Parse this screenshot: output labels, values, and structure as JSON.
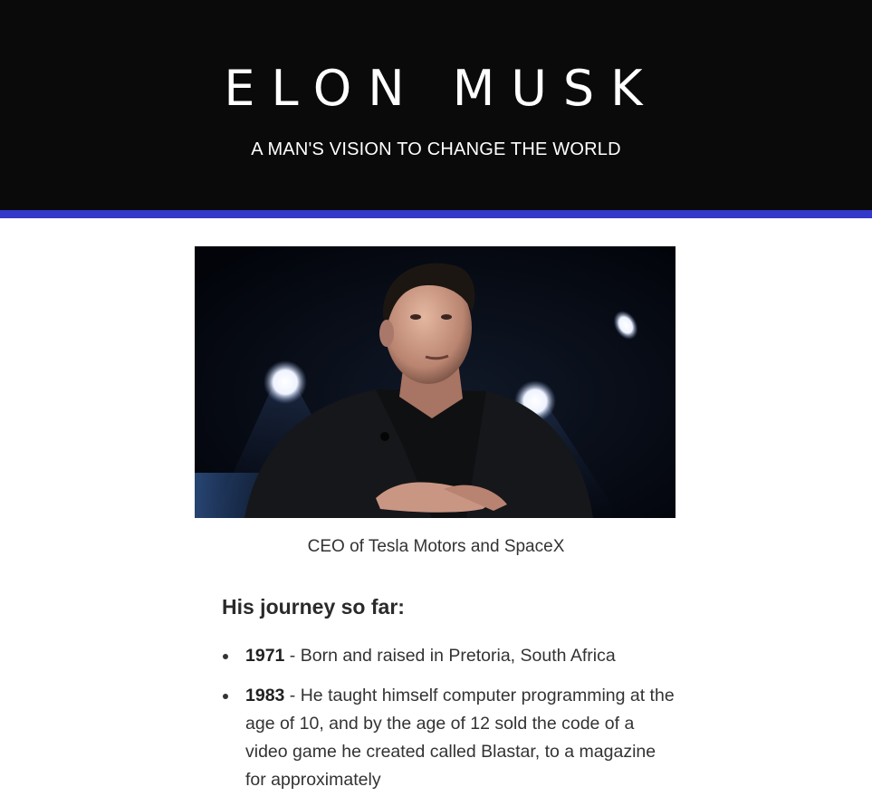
{
  "header": {
    "title": "ELON MUSK",
    "subtitle": "A MAN'S VISION TO CHANGE THE WORLD"
  },
  "hero": {
    "image_alt": "Elon Musk speaking on stage",
    "caption": "CEO of Tesla Motors and SpaceX"
  },
  "journey": {
    "heading": "His journey so far:",
    "items": [
      {
        "year": "1971",
        "text": " - Born and raised in Pretoria, South Africa"
      },
      {
        "year": "1983",
        "text": " - He taught himself computer programming at the age of 10, and by the age of 12 sold the code of a video game he created called Blastar, to a magazine for approximately"
      }
    ]
  },
  "colors": {
    "header_bg": "#0a0a0a",
    "accent_bar": "#3339c9",
    "text": "#333333"
  }
}
